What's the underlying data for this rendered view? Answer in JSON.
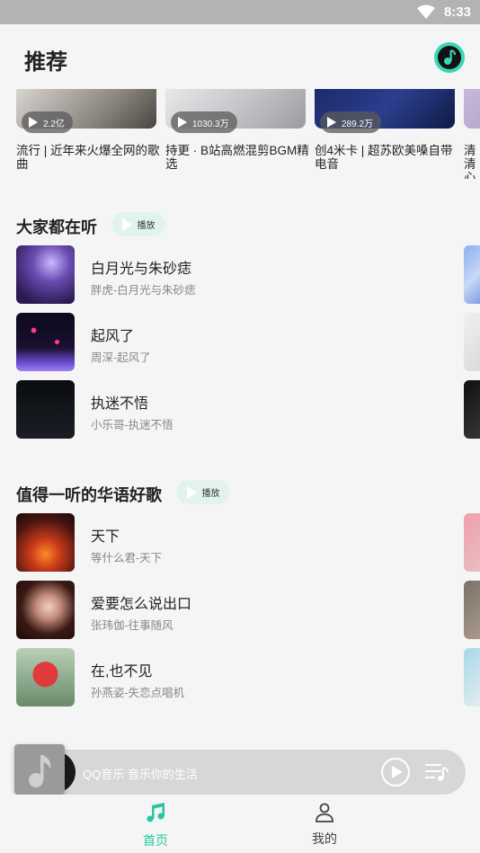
{
  "status_bar": {
    "time": "8:33"
  },
  "header": {
    "title": "推荐"
  },
  "playlists": [
    {
      "play_count": "2.2亿",
      "name": "流行 | 近年来火爆全网的歌曲"
    },
    {
      "play_count": "1030.3万",
      "name": "持更 · B站高燃混剪BGM精选"
    },
    {
      "play_count": "289.2万",
      "name": "创4米卡 | 超苏欧美嗓自带电音"
    },
    {
      "play_count": "",
      "name": "清清心"
    }
  ],
  "section1": {
    "title": "大家都在听",
    "play_label": "播放",
    "songs": [
      {
        "title": "白月光与朱砂痣",
        "subtitle": "胖虎-白月光与朱砂痣"
      },
      {
        "title": "起风了",
        "subtitle": "周深-起风了"
      },
      {
        "title": "执迷不悟",
        "subtitle": "小乐哥-执迷不悟"
      }
    ]
  },
  "section2": {
    "title": "值得一听的华语好歌",
    "play_label": "播放",
    "songs": [
      {
        "title": "天下",
        "subtitle": "等什么君-天下"
      },
      {
        "title": "爱要怎么说出口",
        "subtitle": "张玮伽-往事随风"
      },
      {
        "title": "在,也不见",
        "subtitle": "孙燕姿-失恋点唱机"
      }
    ]
  },
  "mini_player": {
    "text": "QQ音乐 音乐你的生活"
  },
  "bottom_nav": {
    "home_label": "首页",
    "me_label": "我的"
  },
  "colors": {
    "accent": "#23c89e",
    "pill_bg": "#e2f3ee",
    "status_bar": "#b3b3b3"
  }
}
